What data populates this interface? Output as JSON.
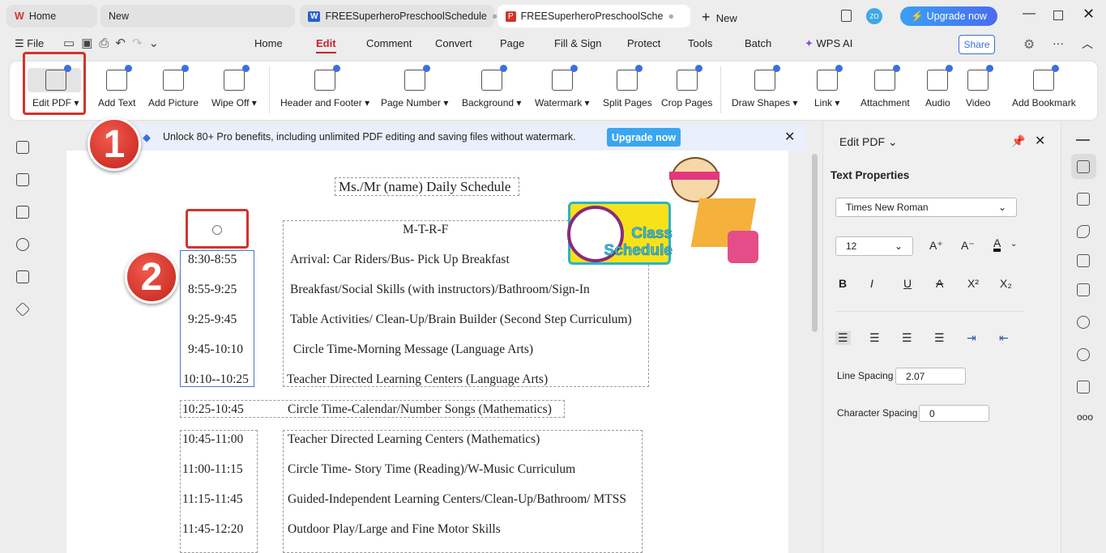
{
  "tabs": [
    {
      "label": "Home"
    },
    {
      "label": "New"
    },
    {
      "label": "FREESuperheroPreschoolSchedule"
    },
    {
      "label": "FREESuperheroPreschoolSche"
    },
    {
      "label": "New"
    }
  ],
  "title_bar": {
    "avatar": "ZO",
    "upgrade": "Upgrade now"
  },
  "menu": {
    "file": "File",
    "items": [
      "Home",
      "Edit",
      "Comment",
      "Convert",
      "Page",
      "Fill & Sign",
      "Protect",
      "Tools",
      "Batch"
    ],
    "ai": "WPS AI",
    "share": "Share"
  },
  "ribbon": [
    "Edit PDF ▾",
    "Add Text",
    "Add Picture",
    "Wipe Off ▾",
    "Header and Footer ▾",
    "Page Number ▾",
    "Background ▾",
    "Watermark ▾",
    "Split Pages",
    "Crop Pages",
    "Draw Shapes ▾",
    "Link ▾",
    "Attachment",
    "Audio",
    "Video",
    "Add Bookmark"
  ],
  "banner": {
    "text": "Unlock 80+ Pro benefits, including unlimited PDF editing and saving files without watermark.",
    "button": "Upgrade now"
  },
  "callouts": [
    "1",
    "2"
  ],
  "document": {
    "title": "Ms./Mr (name) Daily Schedule",
    "days": "M-T-R-F",
    "logo": "Class Schedule",
    "rows": [
      [
        "8:30-8:55",
        "Arrival: Car Riders/Bus- Pick Up Breakfast"
      ],
      [
        "8:55-9:25",
        "Breakfast/Social Skills (with instructors)/Bathroom/Sign-In"
      ],
      [
        "9:25-9:45",
        "Table Activities/ Clean-Up/Brain Builder (Second Step Curriculum)"
      ],
      [
        "9:45-10:10",
        " Circle Time-Morning Message (Language Arts)"
      ],
      [
        "10:10--10:25",
        "Teacher Directed Learning Centers (Language Arts)"
      ],
      [
        "10:25-10:45",
        "Circle Time-Calendar/Number Songs (Mathematics)"
      ],
      [
        "10:45-11:00",
        "Teacher Directed Learning Centers (Mathematics)"
      ],
      [
        "11:00-11:15",
        "Circle Time- Story Time (Reading)/W-Music Curriculum"
      ],
      [
        "11:15-11:45",
        "Guided-Independent Learning Centers/Clean-Up/Bathroom/ MTSS"
      ],
      [
        "11:45-12:20",
        "Outdoor Play/Large and Fine Motor Skills"
      ]
    ]
  },
  "panel": {
    "title": "Edit PDF",
    "section": "Text Properties",
    "font": "Times New Roman",
    "size": "12",
    "format": [
      "B",
      "I",
      "U",
      "A",
      "X²",
      "X₂"
    ],
    "line_spacing_label": "Line Spacing",
    "line_spacing": "2.07",
    "char_spacing_label": "Character Spacing",
    "char_spacing": "0",
    "increase": "A⁺",
    "decrease": "A⁻",
    "color": "A"
  }
}
